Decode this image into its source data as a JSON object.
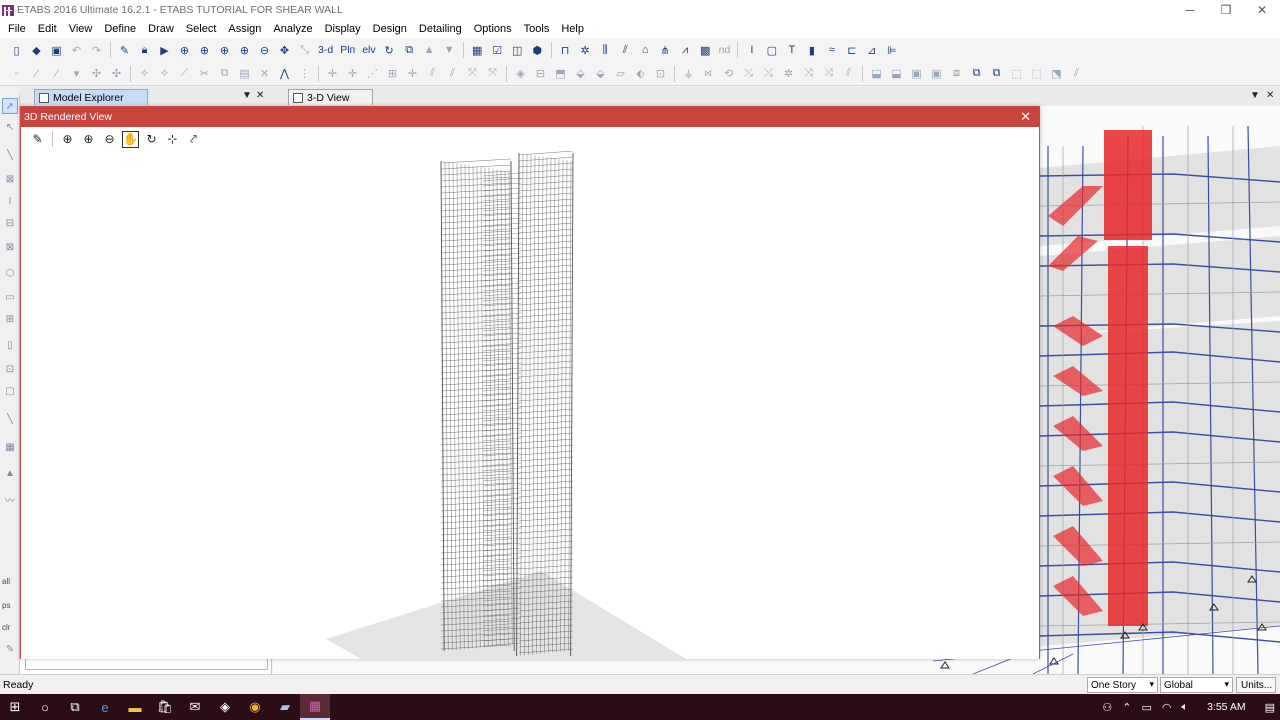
{
  "window": {
    "title": "ETABS 2016 Ultimate 16.2.1 - ETABS TUTORIAL FOR SHEAR WALL",
    "minimize": "─",
    "maximize": "❐",
    "close": "✕"
  },
  "menu": [
    "File",
    "Edit",
    "View",
    "Define",
    "Draw",
    "Select",
    "Assign",
    "Analyze",
    "Display",
    "Design",
    "Detailing",
    "Options",
    "Tools",
    "Help"
  ],
  "toolbar1": {
    "label_3d": "3-d",
    "label_plan": "Plп",
    "label_elev": "elv",
    "label_nd": "nd"
  },
  "tabs": {
    "model_explorer": "Model Explorer",
    "view_3d": "3-D View",
    "dropdown_glyph": "▼",
    "close_glyph": "✕"
  },
  "left_toolbar_labels": [
    "all",
    "ps",
    "clr"
  ],
  "render_window": {
    "title": "3D Rendered View",
    "close": "✕"
  },
  "status": {
    "text": "Ready",
    "story_select": "One Story",
    "coord_select": "Global",
    "units_button": "Units..."
  },
  "taskbar": {
    "time": "3:55 AM"
  },
  "colors": {
    "render_title_bg": "#c9443c",
    "taskbar_bg": "#2b0d16",
    "wall_red": "#e8282a",
    "grid_blue": "#3a4fa0"
  }
}
